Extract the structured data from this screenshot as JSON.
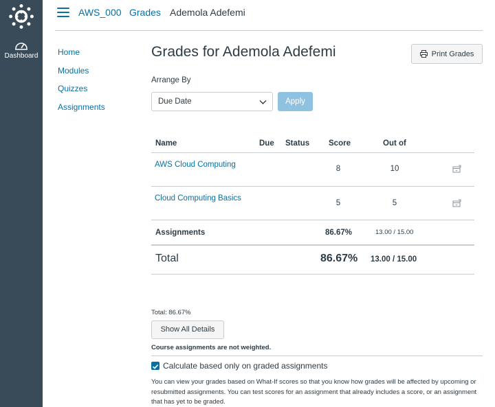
{
  "global_nav": {
    "dashboard_label": "Dashboard"
  },
  "breadcrumb": {
    "course": "AWS_000",
    "section": "Grades",
    "student": "Ademola Adefemi"
  },
  "course_nav": {
    "items": [
      "Home",
      "Modules",
      "Quizzes",
      "Assignments"
    ]
  },
  "page": {
    "title": "Grades for Ademola Adefemi",
    "print_label": "Print Grades"
  },
  "arrange": {
    "label": "Arrange By",
    "selected": "Due Date",
    "apply_label": "Apply"
  },
  "table": {
    "headers": {
      "name": "Name",
      "due": "Due",
      "status": "Status",
      "score": "Score",
      "out_of": "Out of"
    },
    "rows": [
      {
        "name": "AWS Cloud Computing",
        "score": "8",
        "out_of": "10"
      },
      {
        "name": "Cloud Computing Basics",
        "score": "5",
        "out_of": "5"
      }
    ],
    "group": {
      "name": "Assignments",
      "percent": "86.67%",
      "points": "13.00 / 15.00"
    },
    "total": {
      "label": "Total",
      "percent": "86.67%",
      "points": "13.00 / 15.00"
    }
  },
  "summary": {
    "total_text": "Total: 86.67%",
    "show_details_label": "Show All Details",
    "weight_note": "Course assignments are not weighted.",
    "checkbox_label": "Calculate based only on graded assignments",
    "checkbox_checked": true,
    "whatif_text": "You can view your grades based on What-If scores so that you know how grades will be affected by upcoming or resubmitted assignments. You can test scores for an assignment that already includes a score, or an assignment that has yet to be graded."
  },
  "colors": {
    "nav_bg": "#394b58",
    "link": "#0770a3",
    "apply_disabled": "#8fc2e0"
  }
}
